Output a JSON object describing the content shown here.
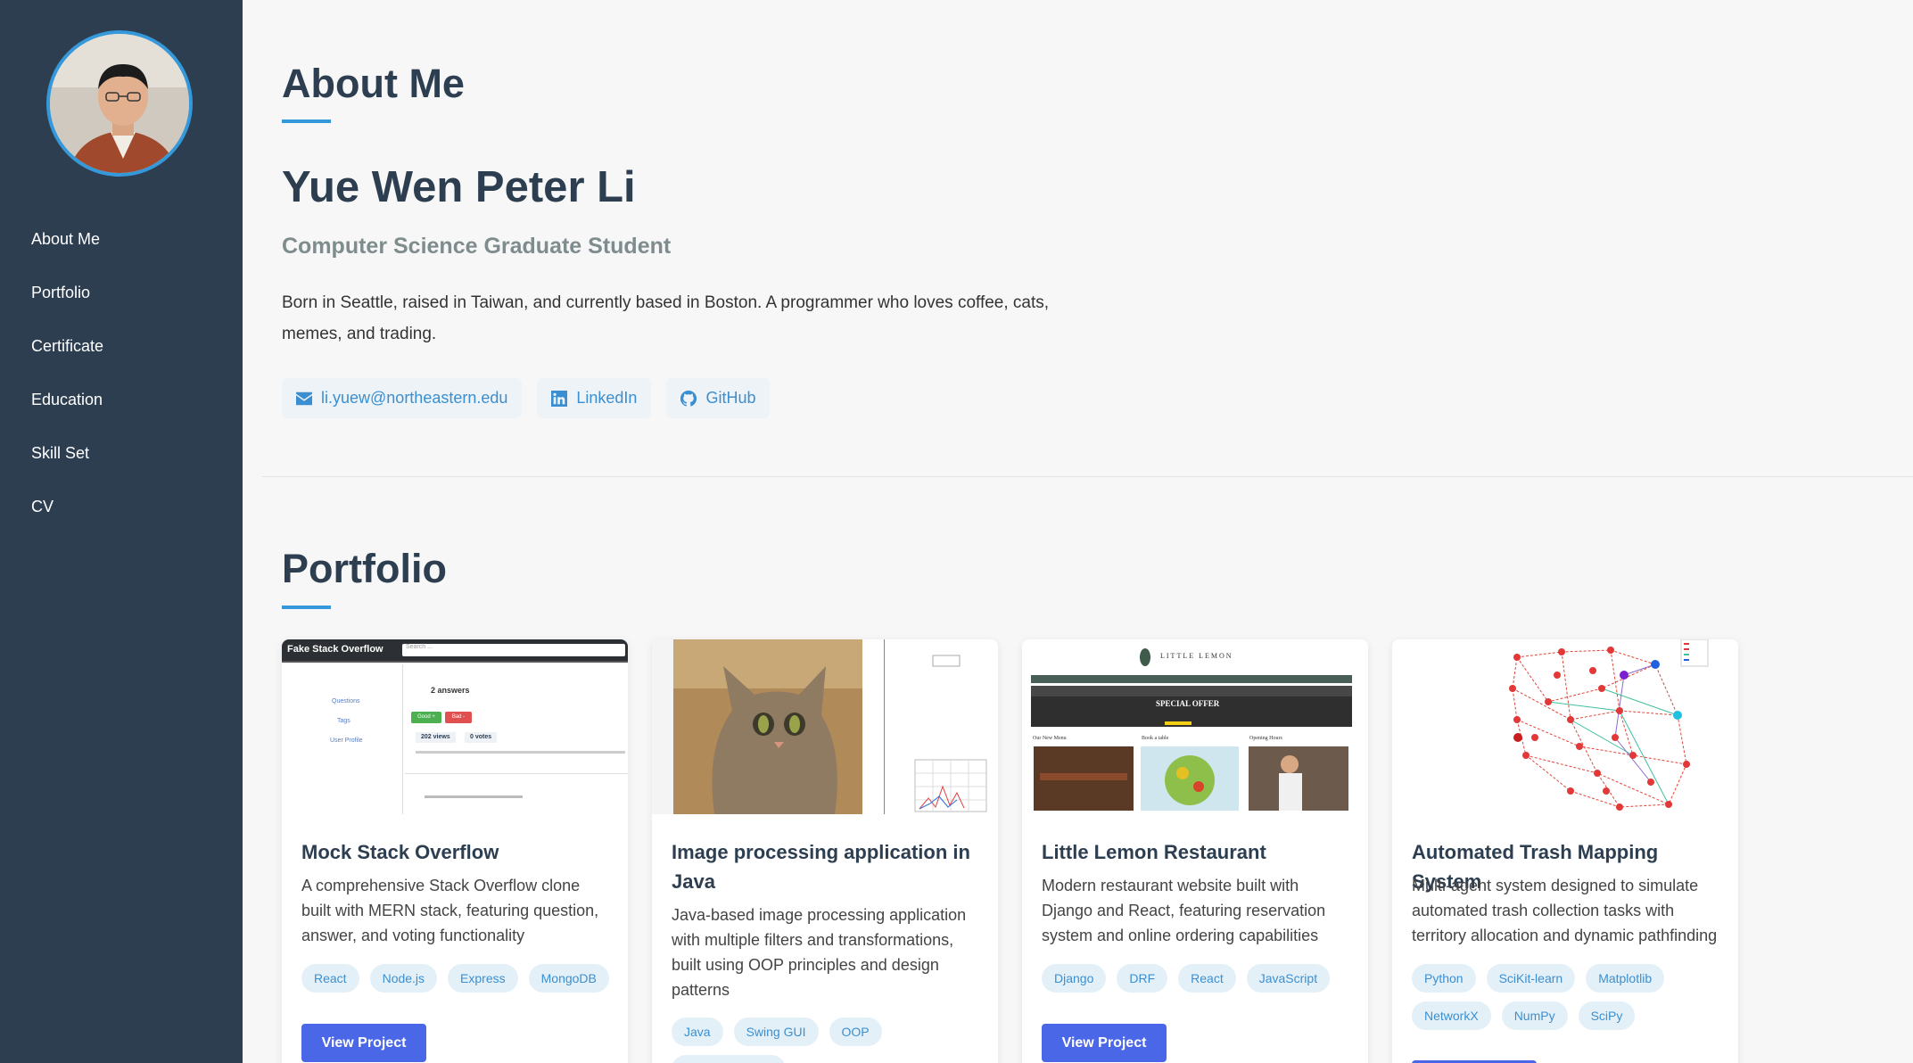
{
  "nav": [
    "About Me",
    "Portfolio",
    "Certificate",
    "Education",
    "Skill Set",
    "CV"
  ],
  "about": {
    "heading": "About Me",
    "name": "Yue Wen Peter Li",
    "role": "Computer Science Graduate Student",
    "bio": "Born in Seattle, raised in Taiwan, and currently based in Boston. A programmer who loves coffee, cats, memes, and trading.",
    "links": [
      {
        "label": "li.yuew@northeastern.edu",
        "icon": "envelope-icon"
      },
      {
        "label": "LinkedIn",
        "icon": "linkedin-icon"
      },
      {
        "label": "GitHub",
        "icon": "github-icon"
      }
    ]
  },
  "portfolio": {
    "heading": "Portfolio",
    "button_label": "View Project",
    "projects": [
      {
        "title": "Mock Stack Overflow",
        "description": "A comprehensive Stack Overflow clone built with MERN stack, featuring question, answer, and voting functionality",
        "tags": [
          "React",
          "Node.js",
          "Express",
          "MongoDB"
        ],
        "thumb": {
          "brand": "Fake Stack Overflow",
          "search": "Search ...",
          "answers": "2 answers",
          "views": "202 views",
          "votes": "0 votes",
          "side": [
            "Questions",
            "Tags",
            "User Profile"
          ],
          "b1": "Good +",
          "b2": "Bad -"
        }
      },
      {
        "title": "Image processing application in Java",
        "description": "Java-based image processing application with multiple filters and transformations, built using OOP principles and design patterns",
        "tags": [
          "Java",
          "Swing GUI",
          "OOP",
          "Design Patterns"
        ]
      },
      {
        "title": "Little Lemon Restaurant",
        "description": "Modern restaurant website built with Django and React, featuring reservation system and online ordering capabilities",
        "tags": [
          "Django",
          "DRF",
          "React",
          "JavaScript"
        ],
        "thumb": {
          "brand": "LITTLE LEMON",
          "offer": "SPECIAL OFFER",
          "sections": [
            "Our New Menu",
            "Book a table",
            "Opening Hours"
          ]
        }
      },
      {
        "title": "Automated Trash Mapping System",
        "description": "Multi-agent system designed to simulate automated trash collection tasks with territory allocation and dynamic pathfinding",
        "tags": [
          "Python",
          "SciKit-learn",
          "Matplotlib",
          "NetworkX",
          "NumPy",
          "SciPy"
        ]
      }
    ]
  },
  "colors": {
    "sidebar": "#2c3e50",
    "accent": "#3498db",
    "button": "#4a67e8"
  }
}
